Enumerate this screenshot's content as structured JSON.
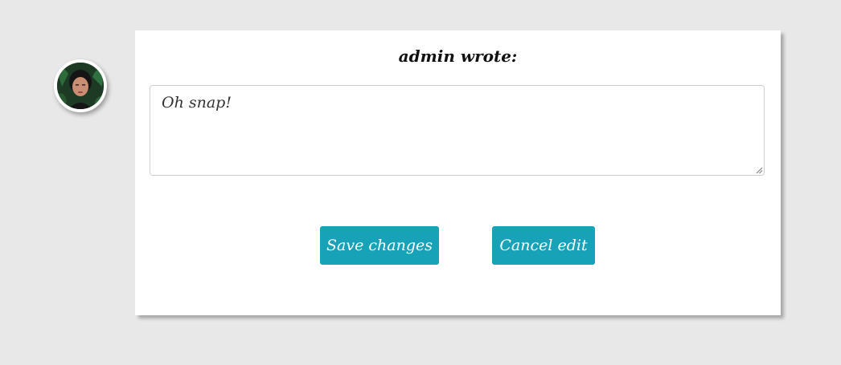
{
  "post": {
    "heading": "admin wrote:",
    "body_text": "Oh snap!"
  },
  "actions": {
    "save_label": "Save changes",
    "cancel_label": "Cancel edit"
  },
  "colors": {
    "page_background": "#e8e8e8",
    "card_background": "#ffffff",
    "button_background": "#17a2b8",
    "button_text": "#ffffff"
  },
  "icons": {
    "avatar": "user-avatar-photo",
    "resize": "resize-grip-icon"
  }
}
